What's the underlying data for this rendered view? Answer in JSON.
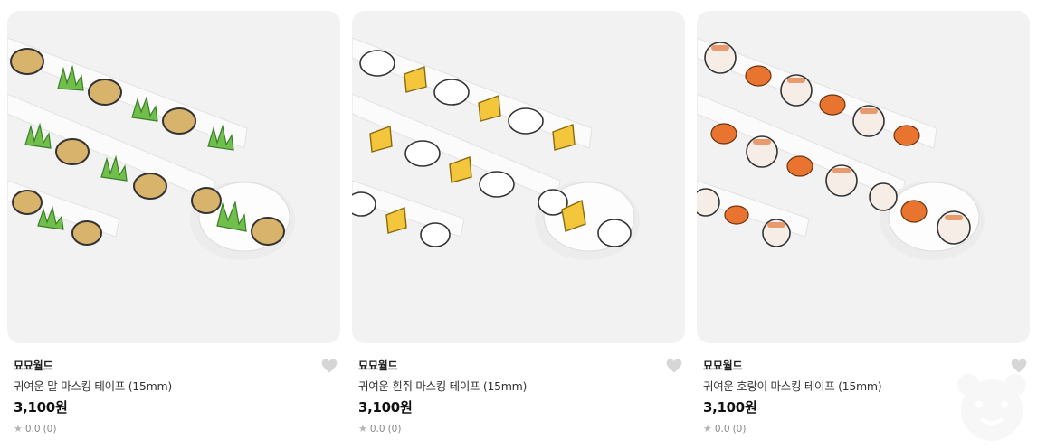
{
  "products": [
    {
      "seller": "묘묘월드",
      "title": "귀여운 말 마스킹 테이프 (15mm)",
      "price": "3,100원",
      "rating": "0.0",
      "review_count": "(0)",
      "pattern": "horse",
      "colors": {
        "main": "#d7b36b",
        "accent": "#6fbf4a"
      }
    },
    {
      "seller": "묘묘월드",
      "title": "귀여운 흰쥐 마스킹 테이프 (15mm)",
      "price": "3,100원",
      "rating": "0.0",
      "review_count": "(0)",
      "pattern": "mouse",
      "colors": {
        "main": "#ffffff",
        "accent": "#f3c63b"
      }
    },
    {
      "seller": "묘묘월드",
      "title": "귀여운 호랑이 마스킹 테이프 (15mm)",
      "price": "3,100원",
      "rating": "0.0",
      "review_count": "(0)",
      "pattern": "tiger",
      "colors": {
        "main": "#e79a6d",
        "accent": "#e8742f"
      }
    }
  ],
  "icons": {
    "wishlist": "heart-icon",
    "rating": "star-icon",
    "floating": "bear-mascot-icon"
  },
  "colors": {
    "thumb_bg": "#f2f2f2",
    "heart": "#d6d6d6"
  }
}
